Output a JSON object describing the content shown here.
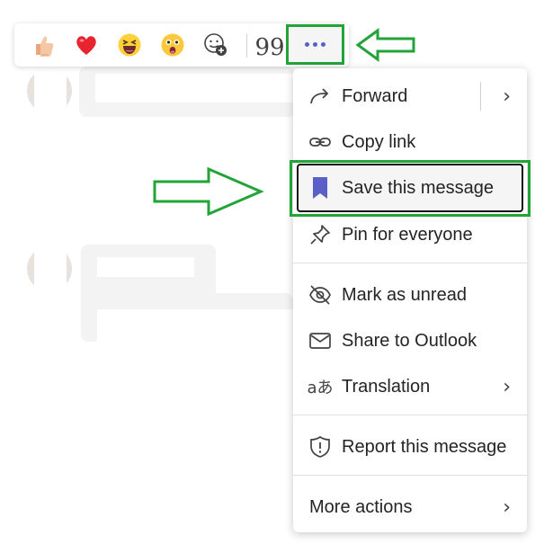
{
  "reactions": [
    {
      "name": "like",
      "icon": "thumbs-up-icon"
    },
    {
      "name": "heart",
      "icon": "heart-icon"
    },
    {
      "name": "laugh",
      "icon": "laughing-face-icon"
    },
    {
      "name": "surprised",
      "icon": "surprised-face-icon"
    },
    {
      "name": "add-reaction",
      "icon": "add-emoji-icon"
    }
  ],
  "quote_glyph": "99",
  "more_options": {
    "icon": "more-options-icon"
  },
  "menu": {
    "forward": "Forward",
    "copy_link": "Copy link",
    "save_message": "Save this message",
    "pin": "Pin for everyone",
    "mark_unread": "Mark as unread",
    "share_outlook": "Share to Outlook",
    "translation": "Translation",
    "report": "Report this message",
    "more_actions": "More actions"
  },
  "colors": {
    "highlight_green": "#22a439",
    "accent": "#5b5fc7"
  }
}
